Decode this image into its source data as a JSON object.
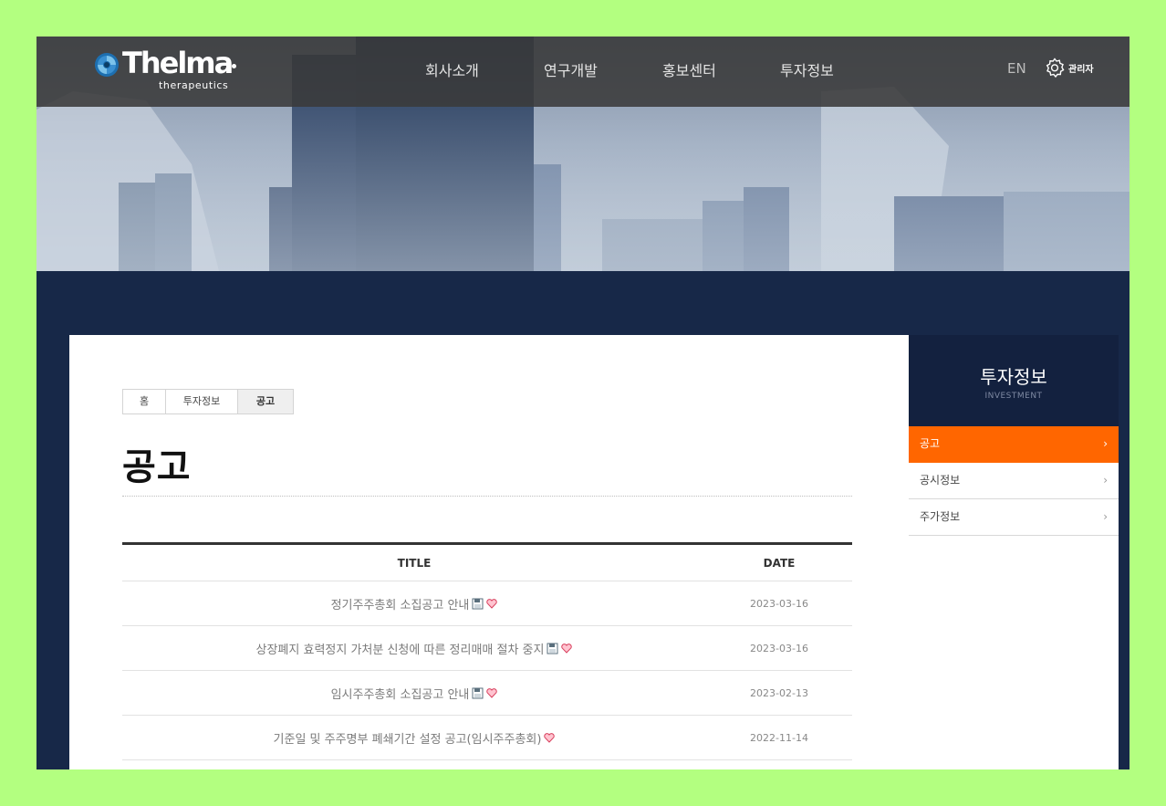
{
  "header": {
    "logo_word": "Thelma",
    "logo_sub": "therapeutics",
    "nav": [
      {
        "label": "회사소개"
      },
      {
        "label": "연구개발"
      },
      {
        "label": "홍보센터"
      },
      {
        "label": "투자정보"
      }
    ],
    "lang": "EN",
    "admin_label": "관리자"
  },
  "breadcrumb": [
    "홈",
    "투자정보",
    "공고"
  ],
  "page_title": "공고",
  "table": {
    "headers": {
      "title": "TITLE",
      "date": "DATE"
    },
    "rows": [
      {
        "title": "정기주주총회 소집공고 안내",
        "date": "2023-03-16",
        "icons": [
          "file-icon",
          "heart-icon"
        ]
      },
      {
        "title": "상장폐지 효력정지 가처분 신청에 따른 정리매매 절차 중지",
        "date": "2023-03-16",
        "icons": [
          "file-icon",
          "heart-icon"
        ]
      },
      {
        "title": "임시주주총회 소집공고 안내",
        "date": "2023-02-13",
        "icons": [
          "file-icon",
          "heart-icon"
        ]
      },
      {
        "title": "기준일 및 주주명부 폐쇄기간 설정 공고(임시주주총회)",
        "date": "2022-11-14",
        "icons": [
          "heart-icon"
        ]
      }
    ]
  },
  "sidebar": {
    "title": "투자정보",
    "subtitle": "INVESTMENT",
    "items": [
      {
        "label": "공고",
        "active": true
      },
      {
        "label": "공시정보",
        "active": false
      },
      {
        "label": "주가정보",
        "active": false
      }
    ]
  },
  "colors": {
    "accent": "#ff6600",
    "navy": "#172848",
    "header": "#3a3a3a",
    "page_bg": "#b3ff80"
  }
}
